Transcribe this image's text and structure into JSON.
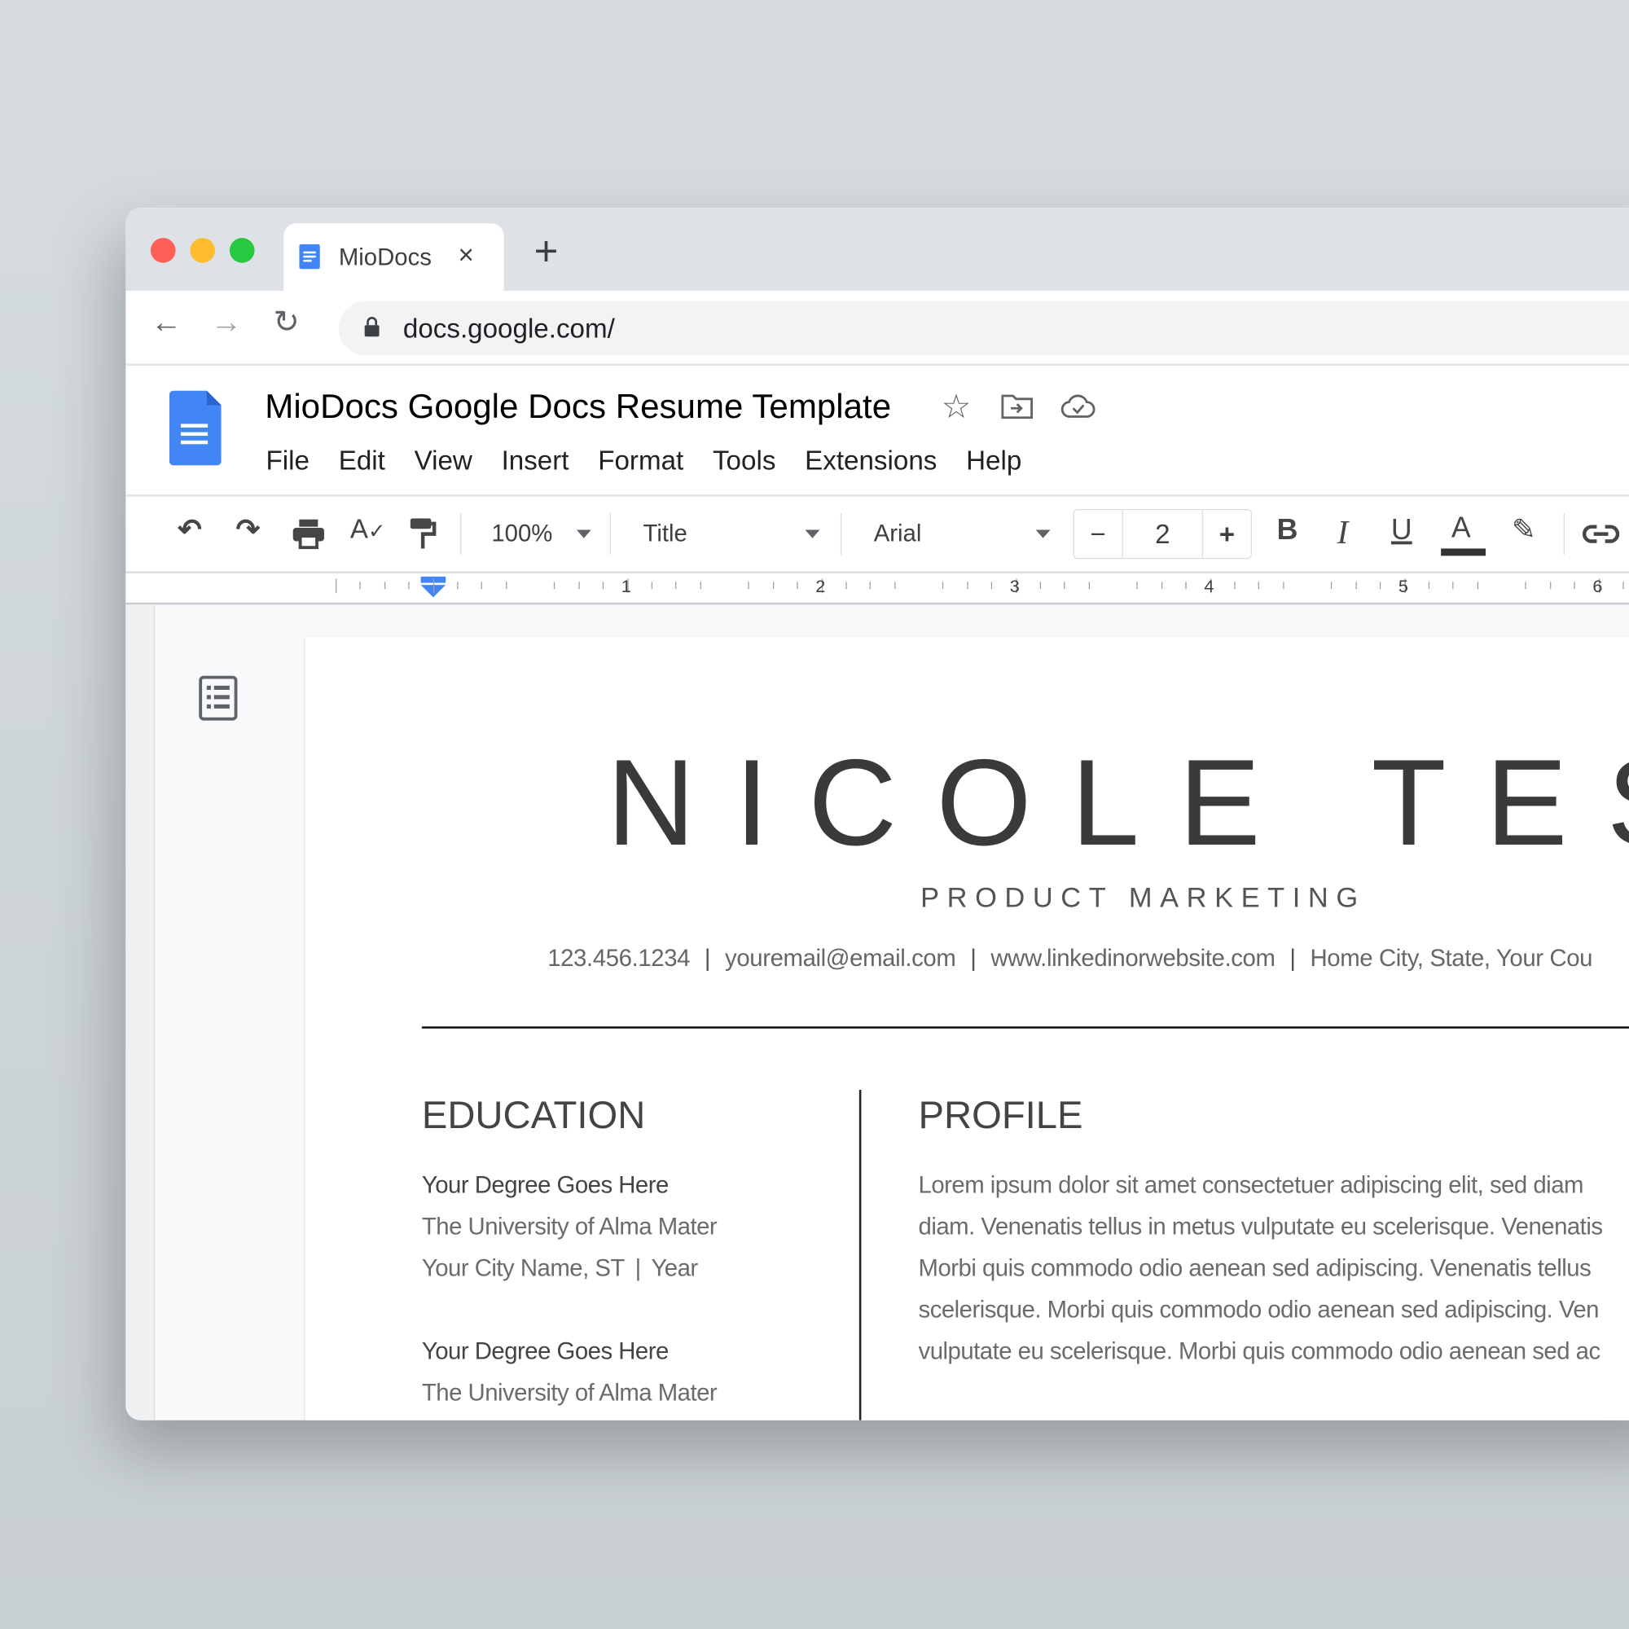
{
  "browser": {
    "traffic_lights": {
      "close": "#ff5f57",
      "minimize": "#febc2e",
      "maximize": "#28c840"
    },
    "tab": {
      "title": "MioDocs",
      "icon": "docs-icon",
      "close": "×"
    },
    "new_tab": "+",
    "url": "docs.google.com/"
  },
  "docs": {
    "title": "MioDocs Google Docs Resume Template",
    "menu": [
      "File",
      "Edit",
      "View",
      "Insert",
      "Format",
      "Tools",
      "Extensions",
      "Help"
    ],
    "toolbar": {
      "zoom": "100%",
      "style": "Title",
      "font": "Arial",
      "font_size": "2",
      "minus": "−",
      "plus": "+",
      "bold": "B",
      "italic": "I",
      "underline": "U",
      "text_color": "A"
    },
    "ruler": [
      "1",
      "2",
      "3",
      "4",
      "5",
      "6"
    ],
    "accent": "#4285f4"
  },
  "resume": {
    "name": "NICOLE TESLA",
    "subtitle": "PRODUCT MARKETING",
    "contact": [
      "123.456.1234",
      "youremail@email.com",
      "www.linkedinorwebsite.com",
      "Home City, State, Your Cou"
    ],
    "education": {
      "heading": "EDUCATION",
      "entries": [
        {
          "degree": "Your Degree Goes Here",
          "school": "The University of Alma Mater",
          "location": "Your City Name, ST",
          "year": "Year"
        },
        {
          "degree": "Your Degree Goes Here",
          "school": "The University of Alma Mater"
        }
      ]
    },
    "profile": {
      "heading": "PROFILE",
      "lines": [
        "Lorem ipsum dolor sit amet consectetuer adipiscing elit, sed diam",
        "diam. Venenatis tellus in metus vulputate eu scelerisque. Venenatis",
        "Morbi quis commodo odio aenean sed adipiscing. Venenatis tellus",
        "scelerisque. Morbi quis commodo odio aenean sed adipiscing. Ven",
        "vulputate eu scelerisque. Morbi quis commodo odio aenean sed ac"
      ]
    }
  }
}
